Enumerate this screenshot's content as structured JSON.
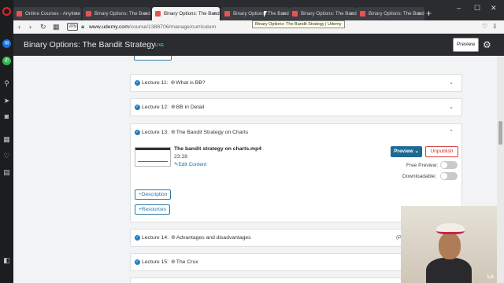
{
  "browser": {
    "tabs": [
      {
        "title": "Online Courses - Anytime"
      },
      {
        "title": "Binary Options: The Band"
      },
      {
        "title": "Binary Options: The Band",
        "active": true
      },
      {
        "title": "Binary Options: The Band"
      },
      {
        "title": "Binary Options: The Band"
      },
      {
        "title": "Binary Options: The Band"
      }
    ],
    "tooltip": "Binary Options: The Bandit Strategy | Udemy",
    "vpn_label": "VPN",
    "url_domain": "www.udemy.com",
    "url_path": "/course/1388706/manage/curriculum"
  },
  "header": {
    "title": "Binary Options: The Bandit Strategy",
    "live_badge": "LIVE",
    "preview_label": "Preview"
  },
  "lectures": [
    {
      "label": "Lecture 11:",
      "title": "What is BB?"
    },
    {
      "label": "Lecture 12:",
      "title": "BB in Detail"
    },
    {
      "label": "Lecture 13:",
      "title": "The Bandit Strategy on Charts"
    },
    {
      "label": "Lecture 14:",
      "title": "Advantages and disadvantages"
    },
    {
      "label": "Lecture 15:",
      "title": "The Crux"
    }
  ],
  "expanded": {
    "file_name": "The bandit strategy on charts.mp4",
    "duration": "23:28",
    "edit_label": "Edit Content",
    "preview_button": "Preview",
    "unpublish_button": "Unpublish",
    "free_preview_label": "Free Preview:",
    "downloadable_label": "Downloadable:",
    "description_button": "Description",
    "resources_button": "Resources"
  },
  "lecture14_partial": "(P",
  "webcam_logo": "LA"
}
